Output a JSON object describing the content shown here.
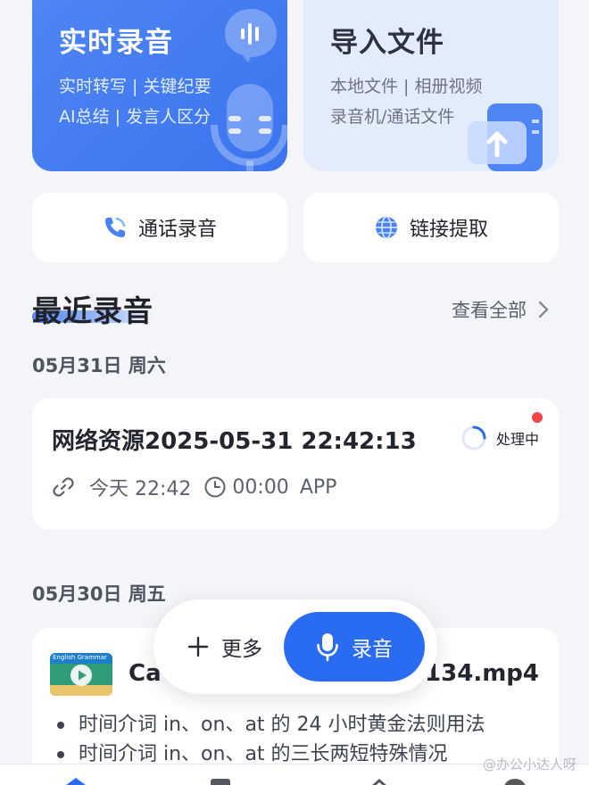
{
  "cards": {
    "live": {
      "title": "实时录音",
      "lines": [
        "实时转写 | 关键纪要",
        "AI总结 | 发言人区分"
      ]
    },
    "import": {
      "title": "导入文件",
      "lines": [
        "本地文件 | 相册视频",
        "录音机/通话文件"
      ]
    }
  },
  "actions": {
    "call": "通话录音",
    "link": "链接提取"
  },
  "recent": {
    "title": "最近录音",
    "view_all": "查看全部"
  },
  "groups": [
    {
      "date": "05月31日 周六",
      "item": {
        "title": "网络资源2025-05-31 22:42:13",
        "status": "处理中",
        "time": "今天 22:42",
        "duration": "00:00",
        "source": "APP"
      }
    },
    {
      "date": "05月30日 周五",
      "item": {
        "title_left": "Ca",
        "title_right": "4134.mp4",
        "thumb_text": "English Grammar",
        "bullets": [
          "时间介词 in、on、at 的 24 小时黄金法则用法",
          "时间介词 in、on、at 的三长两短特殊情况"
        ]
      }
    }
  ],
  "float_bar": {
    "more": "更多",
    "record": "录音"
  },
  "watermark": "@办公小达人呀",
  "colors": {
    "accent": "#2a6cf1",
    "live_card": "#4f86f4",
    "import_card": "#e3ecfb",
    "status_dot": "#f0464a"
  }
}
